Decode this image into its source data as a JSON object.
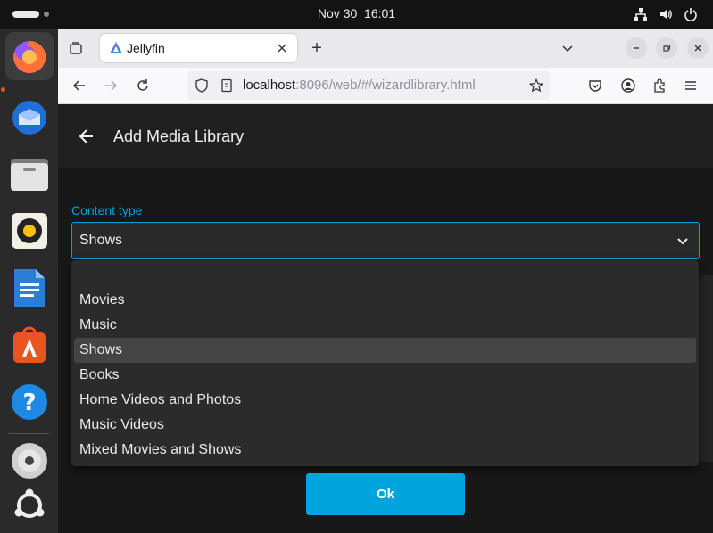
{
  "system_bar": {
    "date": "Nov 30",
    "time": "16:01",
    "icons": [
      "network-icon",
      "volume-icon",
      "power-icon"
    ]
  },
  "dock": {
    "apps": [
      "firefox",
      "thunderbird",
      "files",
      "rhythmbox",
      "libreoffice-writer",
      "app-center",
      "help",
      "optical-drive",
      "ubuntu-show-apps"
    ],
    "active_app": "firefox"
  },
  "browser": {
    "tab": {
      "title": "Jellyfin",
      "favicon": "jellyfin-icon"
    },
    "new_tab_label": "+",
    "url": {
      "host": "localhost",
      "rest": ":8096/web/#/wizardlibrary.html"
    }
  },
  "page": {
    "title": "Add Media Library",
    "content_type": {
      "label": "Content type",
      "selected": "Shows",
      "options": [
        "",
        "Movies",
        "Music",
        "Shows",
        "Books",
        "Home Videos and Photos",
        "Music Videos",
        "Mixed Movies and Shows"
      ],
      "selected_index": 3
    },
    "ok_label": "Ok"
  },
  "colors": {
    "accent": "#00a4dc",
    "header_bg": "#202020",
    "body_bg": "#181818",
    "dropdown_bg": "#2b2b2b",
    "option_selected_bg": "#444444",
    "dock_bg": "#2a2a2a",
    "topbar_bg": "#131313"
  }
}
